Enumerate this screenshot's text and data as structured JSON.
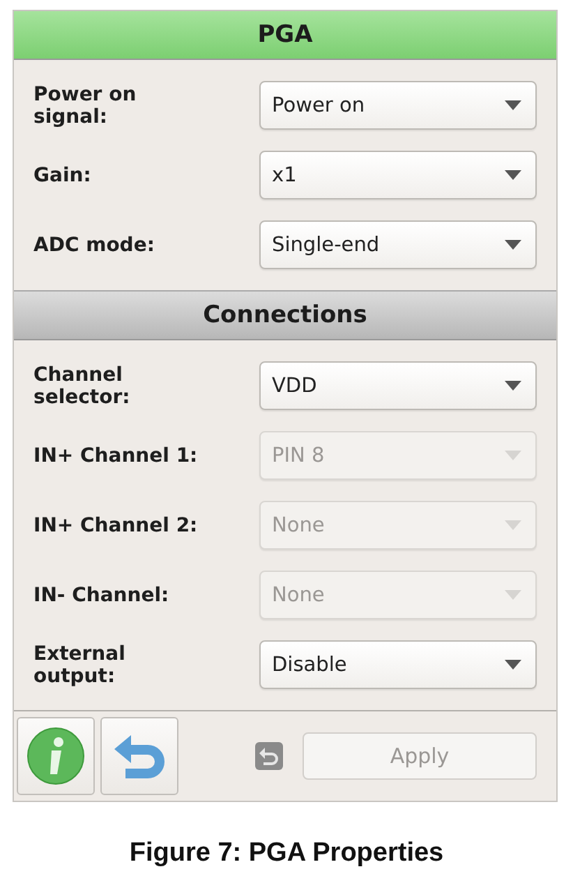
{
  "panel": {
    "title": "PGA"
  },
  "sections": [
    {
      "fields": [
        {
          "label": "Power on signal:",
          "value": "Power on",
          "disabled": false
        },
        {
          "label": "Gain:",
          "value": "x1",
          "disabled": false
        },
        {
          "label": "ADC mode:",
          "value": "Single-end",
          "disabled": false
        }
      ]
    },
    {
      "title": "Connections",
      "fields": [
        {
          "label": "Channel selector:",
          "value": "VDD",
          "disabled": false
        },
        {
          "label": "IN+ Channel 1:",
          "value": "PIN 8",
          "disabled": true
        },
        {
          "label": "IN+ Channel 2:",
          "value": "None",
          "disabled": true
        },
        {
          "label": "IN- Channel:",
          "value": "None",
          "disabled": true
        },
        {
          "label": "External output:",
          "value": "Disable",
          "disabled": false
        }
      ]
    }
  ],
  "footer": {
    "apply": {
      "label": "Apply",
      "disabled": true
    }
  },
  "caption": "Figure 7: PGA Properties"
}
